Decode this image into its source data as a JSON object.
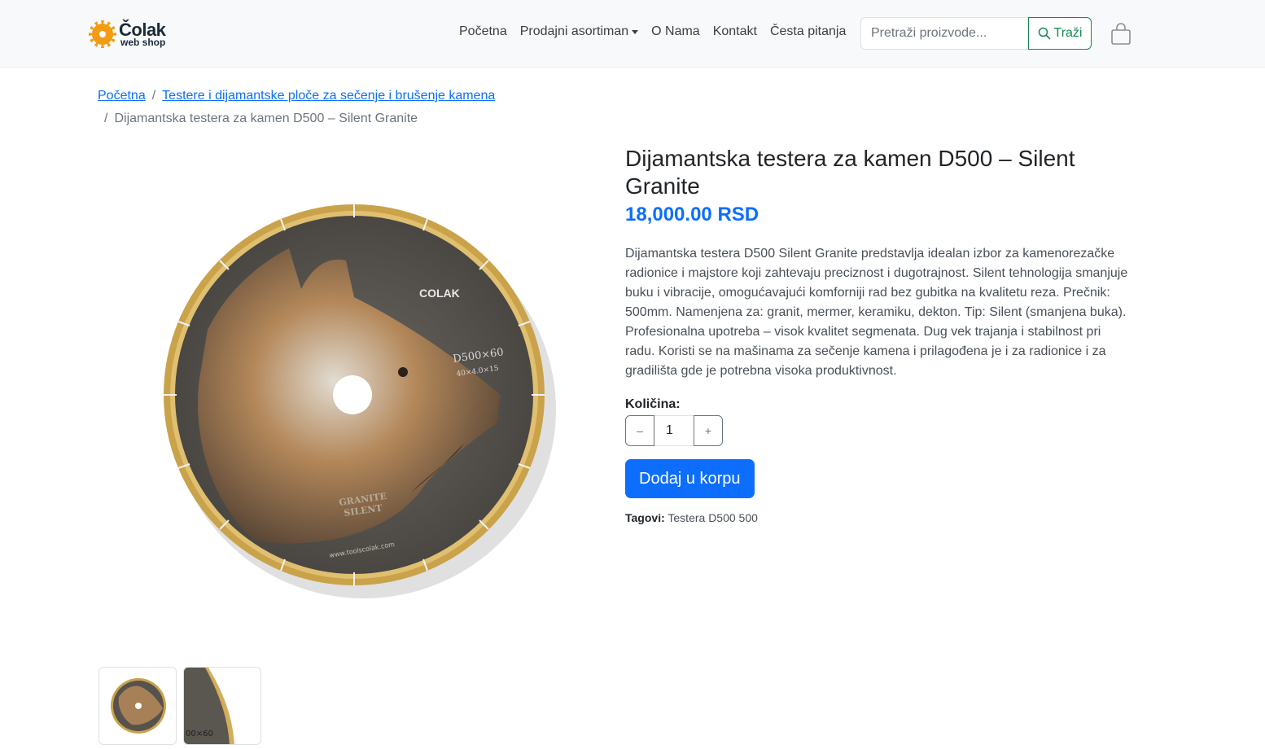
{
  "brand": {
    "name": "Čolak",
    "subtitle": "web shop"
  },
  "nav": {
    "items": [
      {
        "label": "Početna"
      },
      {
        "label": "Prodajni asortiman"
      },
      {
        "label": "O Nama"
      },
      {
        "label": "Kontakt"
      },
      {
        "label": "Česta pitanja"
      }
    ]
  },
  "search": {
    "placeholder": "Pretraži proizvode...",
    "button_label": "Traži"
  },
  "breadcrumb": {
    "home": "Početna",
    "category": "Testere i dijamantske ploče za sečenje i brušenje kamena",
    "current": "Dijamantska testera za kamen D500 – Silent Granite",
    "separator": "/"
  },
  "image_text": {
    "brand_mark": "COLAK",
    "size": "D500×60",
    "spec": "40×4.0×15",
    "line1": "GRANITE",
    "line2": "SILENT",
    "site": "www.toolscolak.com",
    "thumb_label": "00×60"
  },
  "product": {
    "title": "Dijamantska testera za kamen D500 – Silent Granite",
    "price": "18,000.00 RSD",
    "description": "Dijamantska testera D500 Silent Granite predstavlja idealan izbor za kamenorezačke radionice i majstore koji zahtevaju preciznost i dugotrajnost. Silent tehnologija smanjuje buku i vibracije, omogućavajući komforniji rad bez gubitka na kvalitetu reza. Prečnik: 500mm. Namenjena za: granit, mermer, keramiku, dekton. Tip: Silent (smanjena buka). Profesionalna upotreba – visok kvalitet segmenata. Dug vek trajanja i stabilnost pri radu. Koristi se na mašinama za sečenje kamena i prilagođena je i za radionice i za gradilišta gde je potrebna visoka produktivnost.",
    "quantity_label": "Količina:",
    "quantity_value": "1",
    "minus_label": "–",
    "plus_label": "+",
    "add_to_cart_label": "Dodaj u korpu",
    "tags_label": "Tagovi:",
    "tags_value": "Testera D500 500"
  },
  "colors": {
    "primary": "#0d6efd",
    "success": "#198754",
    "navbar_bg": "#f8f9fa"
  }
}
